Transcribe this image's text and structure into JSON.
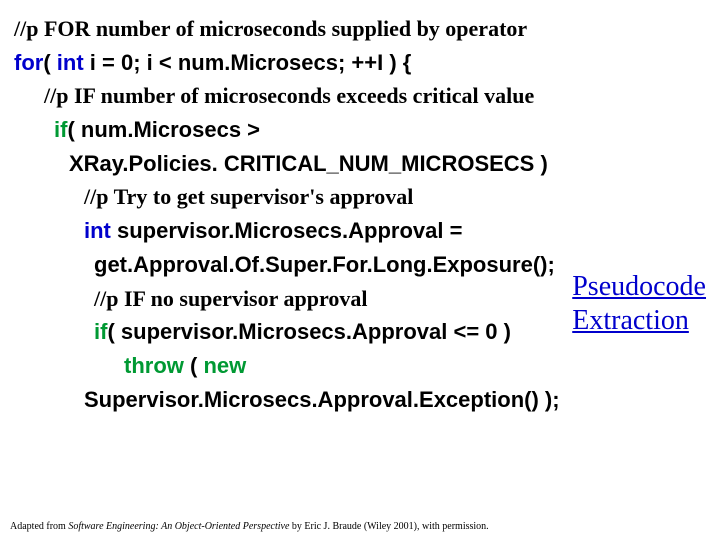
{
  "l1": {
    "pre": "//p FOR number of microseconds supplied by operator"
  },
  "l2": {
    "kw_for": "for",
    "a": "( ",
    "kw_int": "int",
    "b": " i = 0; i < num.Microsecs; ++I ) {"
  },
  "l3": {
    "pre": "//p IF number of microseconds exceeds critical value"
  },
  "l4": {
    "kw_if": "if",
    "a": "( num.Microsecs >"
  },
  "l5": {
    "a": "XRay.Policies. CRITICAL_NUM_MICROSECS )"
  },
  "l6": {
    "pre": "//p Try to get supervisor's approval"
  },
  "l7": {
    "kw_int": "int",
    "a": " supervisor.Microsecs.Approval ="
  },
  "l8": {
    "a": "get.Approval.Of.Super.For.Long.Exposure();"
  },
  "l9": {
    "pre": "//p IF no supervisor approval"
  },
  "l10": {
    "kw_if": "if",
    "a": "( supervisor.Microsecs.Approval <= 0 )"
  },
  "l11": {
    "kw_throw": "throw ",
    "a": "( ",
    "kw_new": "new"
  },
  "l12": {
    "a": "Supervisor.Microsecs.Approval.Exception() );"
  },
  "callout": {
    "line1": "Pseudocode",
    "line2": "Extraction"
  },
  "footer": {
    "a": "Adapted from ",
    "book": "Software Engineering: An Object-Oriented Perspective",
    "b": " by Eric J. Braude (Wiley 2001), with permission."
  }
}
